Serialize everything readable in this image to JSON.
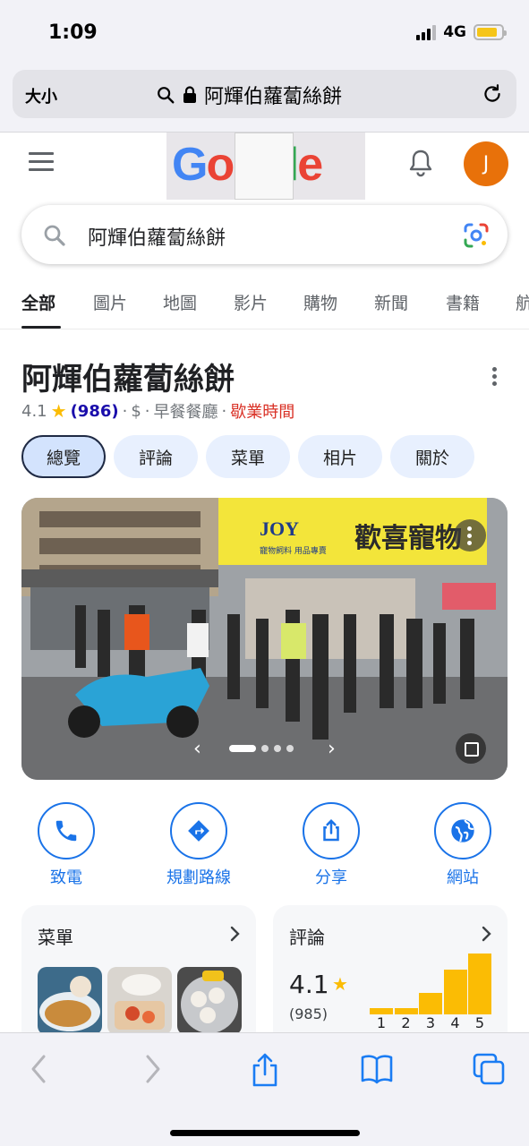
{
  "status_bar": {
    "time": "1:09",
    "network": "4G",
    "battery_level": 0.85
  },
  "browser": {
    "text_size_label": "大小",
    "url_text": "阿輝伯蘿蔔絲餅",
    "toolbar_icons": [
      "back-icon",
      "forward-icon",
      "share-icon",
      "bookmarks-icon",
      "tabs-icon"
    ]
  },
  "google": {
    "account_initial": "J",
    "search_query": "阿輝伯蘿蔔絲餅",
    "tabs": [
      "全部",
      "圖片",
      "地圖",
      "影片",
      "購物",
      "新聞",
      "書籍",
      "航"
    ],
    "active_tab": 0
  },
  "business": {
    "name": "阿輝伯蘿蔔絲餅",
    "rating": "4.1",
    "review_count": "(986)",
    "price": "$",
    "category": "早餐餐廳",
    "hours_status": "歇業時間",
    "chips": [
      "總覽",
      "評論",
      "菜單",
      "相片",
      "關於"
    ],
    "active_chip": 0,
    "photo": {
      "shop_sign_brand": "JOY",
      "shop_sign_sub": "寵物飼料 用品專賣",
      "shop_sign_main": "歡喜寵物",
      "current_slide": 1,
      "total_dots": 4
    },
    "actions": [
      {
        "label": "致電",
        "icon": "phone-icon"
      },
      {
        "label": "規劃路線",
        "icon": "directions-icon"
      },
      {
        "label": "分享",
        "icon": "share-icon"
      },
      {
        "label": "網站",
        "icon": "globe-icon"
      }
    ],
    "menu_card": {
      "title": "菜單"
    },
    "reviews_card": {
      "title": "評論",
      "rating": "4.1",
      "count": "(985)",
      "distribution": [
        {
          "stars": "1",
          "share": 0.11
        },
        {
          "stars": "2",
          "share": 0.11
        },
        {
          "stars": "3",
          "share": 0.35
        },
        {
          "stars": "4",
          "share": 0.73
        },
        {
          "stars": "5",
          "share": 1.0
        }
      ]
    }
  },
  "colors": {
    "accent_blue": "#1a73e8",
    "rating_yellow": "#fbbc04",
    "closed_red": "#d93025",
    "avatar_orange": "#e8710a"
  }
}
